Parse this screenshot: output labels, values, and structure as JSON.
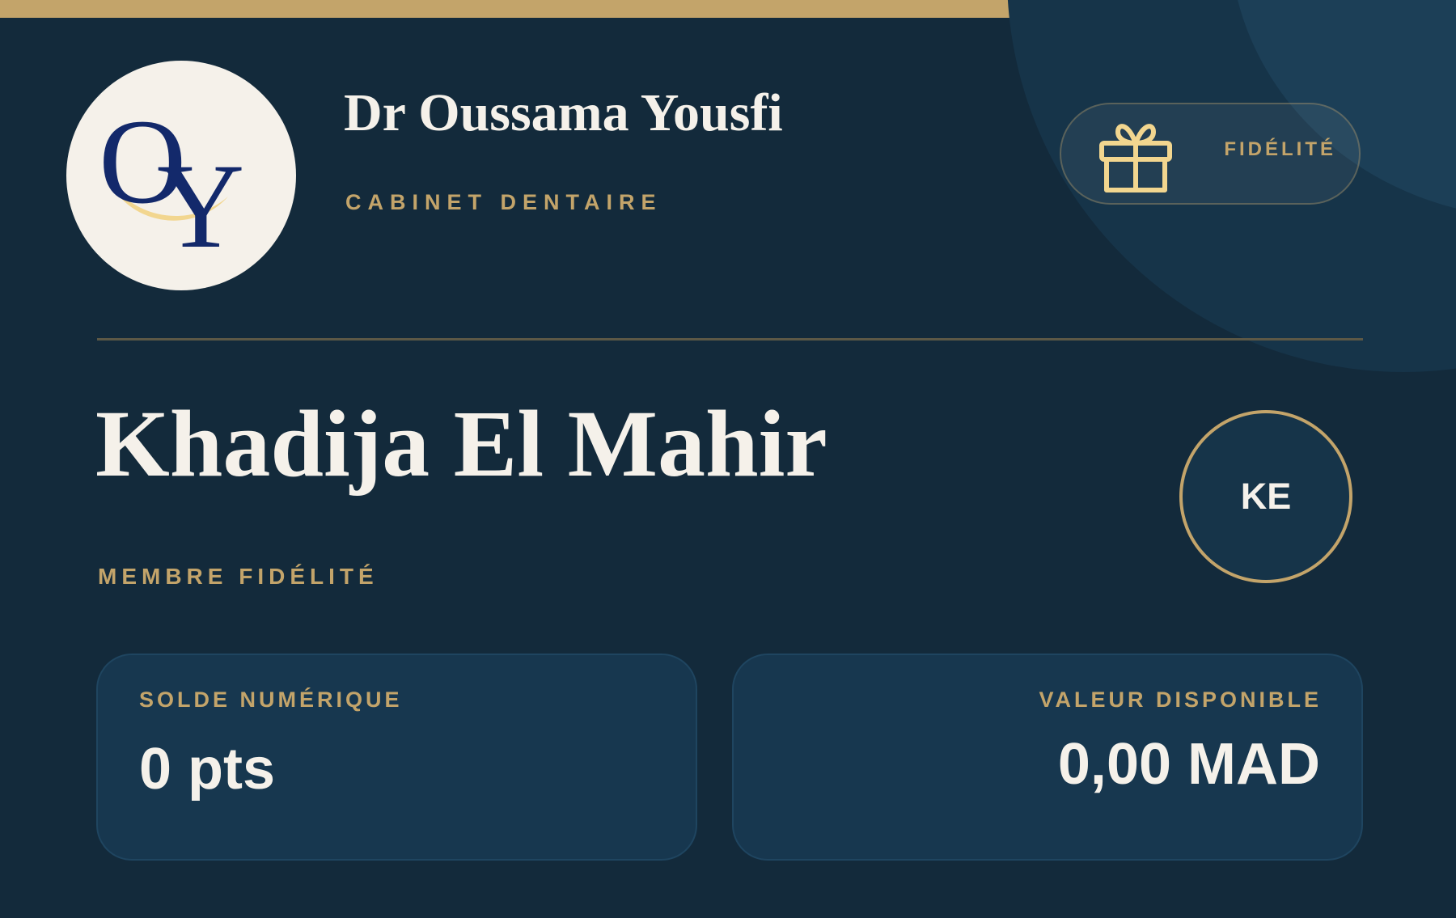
{
  "clinic": {
    "name": "Dr Oussama Yousfi",
    "subtitle": "CABINET DENTAIRE",
    "logo_icon": "oy-monogram-logo"
  },
  "loyalty_badge": {
    "icon": "gift-icon",
    "label": "FIDÉLITÉ"
  },
  "member": {
    "name": "Khadija El Mahir",
    "role": "MEMBRE FIDÉLITÉ",
    "initials": "KE"
  },
  "stats": {
    "balance": {
      "label": "SOLDE NUMÉRIQUE",
      "value": "0 pts"
    },
    "available": {
      "label": "VALEUR DISPONIBLE",
      "value": "0,00 MAD"
    }
  },
  "colors": {
    "background": "#132a3b",
    "accent_gold": "#c3a46a",
    "text_light": "#f5f1ea",
    "panel": "#17374f",
    "logo_navy": "#13296b",
    "logo_gold": "#f2d68f"
  }
}
